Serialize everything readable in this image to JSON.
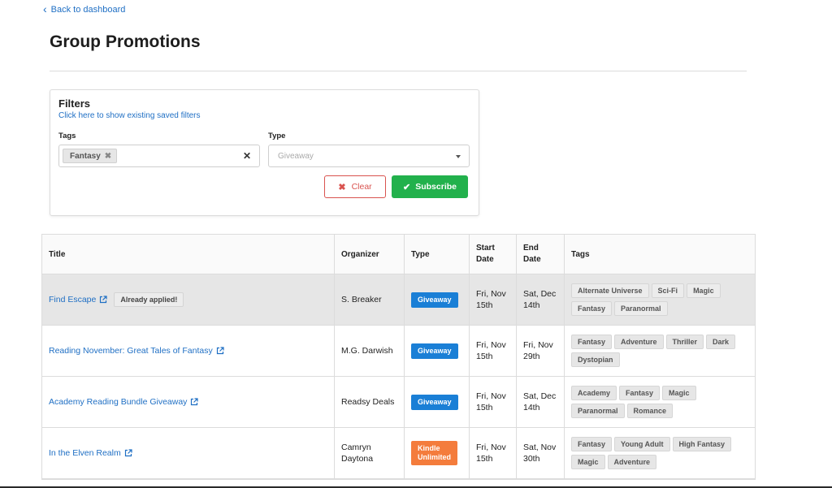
{
  "nav": {
    "back_label": "Back to dashboard"
  },
  "page": {
    "title": "Group Promotions"
  },
  "filters": {
    "title": "Filters",
    "saved_link": "Click here to show existing saved filters",
    "tags_label": "Tags",
    "type_label": "Type",
    "selected_tags": [
      "Fantasy"
    ],
    "type_placeholder": "Giveaway",
    "clear_label": "Clear",
    "subscribe_label": "Subscribe"
  },
  "table": {
    "headers": {
      "title": "Title",
      "organizer": "Organizer",
      "type": "Type",
      "start_line1": "Start",
      "start_line2": "Date",
      "end_line1": "End",
      "end_line2": "Date",
      "tags": "Tags"
    },
    "rows": [
      {
        "title": "Find Escape",
        "badge": "Already applied!",
        "organizer": [
          "S. Breaker"
        ],
        "type": "Giveaway",
        "type_color": "blue",
        "start": [
          "Fri, Nov",
          "15th"
        ],
        "end": [
          "Sat, Dec",
          "14th"
        ],
        "tags": [
          "Alternate Universe",
          "Sci-Fi",
          "Magic",
          "Fantasy",
          "Paranormal"
        ]
      },
      {
        "title": "Reading November: Great Tales of Fantasy",
        "badge": "",
        "organizer": [
          "M.G. Darwish"
        ],
        "type": "Giveaway",
        "type_color": "blue",
        "start": [
          "Fri, Nov",
          "15th"
        ],
        "end": [
          "Fri, Nov",
          "29th"
        ],
        "tags": [
          "Fantasy",
          "Adventure",
          "Thriller",
          "Dark",
          "Dystopian"
        ]
      },
      {
        "title": "Academy Reading Bundle Giveaway",
        "badge": "",
        "organizer": [
          "Readsy Deals"
        ],
        "type": "Giveaway",
        "type_color": "blue",
        "start": [
          "Fri, Nov",
          "15th"
        ],
        "end": [
          "Sat, Dec",
          "14th"
        ],
        "tags": [
          "Academy",
          "Fantasy",
          "Magic",
          "Paranormal",
          "Romance"
        ]
      },
      {
        "title": "In the Elven Realm",
        "badge": "",
        "organizer": [
          "Camryn",
          "Daytona"
        ],
        "type": "Kindle Unlimited",
        "type_lines": [
          "Kindle",
          "Unlimited"
        ],
        "type_color": "orange",
        "start": [
          "Fri, Nov",
          "15th"
        ],
        "end": [
          "Sat, Nov",
          "30th"
        ],
        "tags": [
          "Fantasy",
          "Young Adult",
          "High Fantasy",
          "Magic",
          "Adventure"
        ]
      }
    ]
  },
  "colors": {
    "link": "#1f6fc4",
    "giveaway_badge": "#1a7fd6",
    "kindle_badge": "#f47c3c",
    "subscribe_button": "#22b14c",
    "clear_button": "#d9534f",
    "highlight_row": "#e6e6e6"
  },
  "icons": {
    "back": "chevron-left-icon",
    "remove_tag": "close-icon",
    "clear_select": "close-icon",
    "dropdown": "caret-down-icon",
    "clear_button": "close-icon",
    "subscribe_button": "check-icon",
    "external_link": "external-link-icon"
  }
}
